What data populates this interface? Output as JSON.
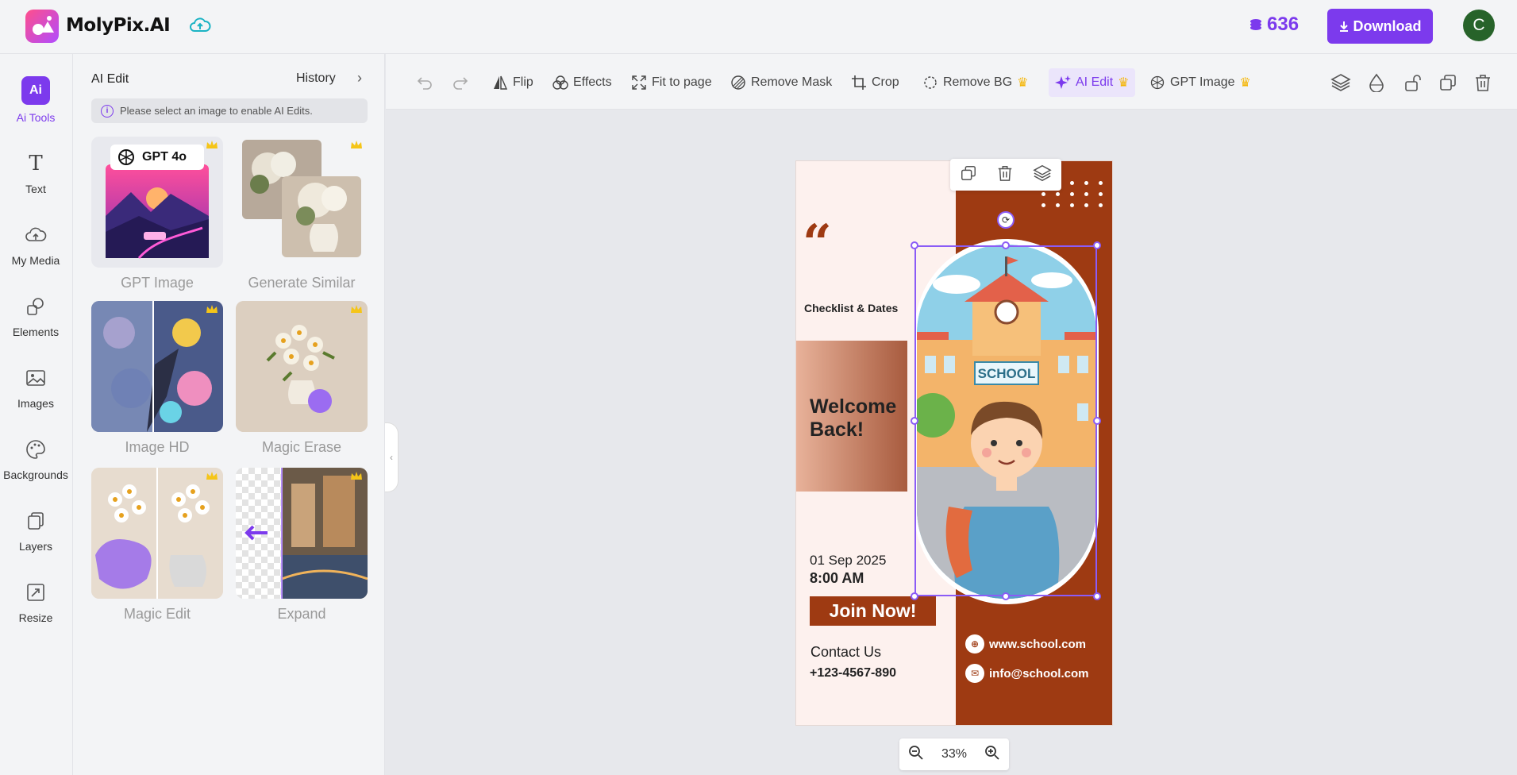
{
  "app": {
    "name": "MolyPix.AI",
    "credits": "636",
    "download_label": "Download",
    "avatar_letter": "C"
  },
  "rail": [
    {
      "label": "Ai Tools",
      "icon": "ai-tools-icon"
    },
    {
      "label": "Text",
      "icon": "text-icon"
    },
    {
      "label": "My Media",
      "icon": "upload-cloud-icon"
    },
    {
      "label": "Elements",
      "icon": "shapes-icon"
    },
    {
      "label": "Images",
      "icon": "image-icon"
    },
    {
      "label": "Backgrounds",
      "icon": "palette-icon"
    },
    {
      "label": "Layers",
      "icon": "layers-icon"
    },
    {
      "label": "Resize",
      "icon": "resize-icon"
    }
  ],
  "panel": {
    "title": "AI Edit",
    "history": "History",
    "notice": "Please select an image to enable AI Edits.",
    "gpt_badge": "GPT 4o",
    "tools": [
      "GPT Image",
      "Generate Similar",
      "Image HD",
      "Magic Erase",
      "Magic Edit",
      "Expand"
    ]
  },
  "toolbar": {
    "flip": "Flip",
    "effects": "Effects",
    "fit": "Fit to page",
    "remove_mask": "Remove Mask",
    "crop": "Crop",
    "remove_bg": "Remove BG",
    "ai_edit": "AI Edit",
    "gpt_image": "GPT Image"
  },
  "poster": {
    "quote": "“",
    "checklist": "Checklist & Dates",
    "welcome_1": "Welcome",
    "welcome_2": "Back!",
    "date": "01 Sep 2025",
    "time": "8:00 AM",
    "join": "Join Now!",
    "contact": "Contact Us",
    "phone": "+123-4567-890",
    "web": "www.school.com",
    "email": "info@school.com",
    "school_sign": "SCHOOL"
  },
  "zoom": {
    "level": "33%"
  },
  "colors": {
    "accent": "#7c3aed",
    "poster_brown": "#9e3a12",
    "poster_bg": "#fdf1ee"
  }
}
